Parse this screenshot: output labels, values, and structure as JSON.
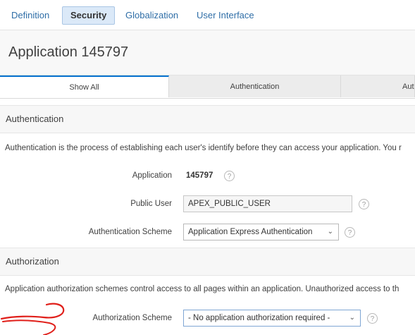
{
  "nav": {
    "items": [
      "Definition",
      "Security",
      "Globalization",
      "User Interface"
    ],
    "active": "Security"
  },
  "page": {
    "title": "Application 145797"
  },
  "tabs": {
    "items": [
      "Show All",
      "Authentication",
      "Aut"
    ],
    "active": "Show All"
  },
  "authentication": {
    "heading": "Authentication",
    "description": "Authentication is the process of establishing each user's identify before they can access your application. You r",
    "application_label": "Application",
    "application_value": "145797",
    "public_user_label": "Public User",
    "public_user_value": "APEX_PUBLIC_USER",
    "scheme_label": "Authentication Scheme",
    "scheme_value": "Application Express Authentication"
  },
  "authorization": {
    "heading": "Authorization",
    "description": "Application authorization schemes control access to all pages within an application. Unauthorized access to th",
    "scheme_label": "Authorization Scheme",
    "scheme_value": "- No application authorization required -"
  },
  "icons": {
    "help": "help-icon",
    "chevron": "chevron-down-icon",
    "annotation": "red-hand-drawn-arrow"
  },
  "colors": {
    "link": "#2f6ea7",
    "active_tab_accent": "#0572ce",
    "annotation": "#e0201b"
  }
}
